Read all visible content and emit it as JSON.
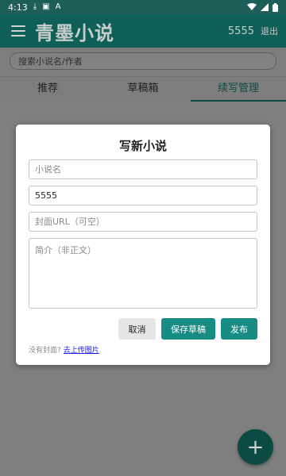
{
  "status_bar": {
    "time": "4:13",
    "icons": [
      "download-icon",
      "a-icon",
      "a-icon",
      "wifi-icon",
      "signal-icon",
      "battery-icon"
    ]
  },
  "app_bar": {
    "menu_icon": "hamburger-menu-icon",
    "title": "青墨小说",
    "username": "5555",
    "logout_label": "退出"
  },
  "search": {
    "placeholder": "搜索小说名/作者",
    "value": ""
  },
  "tabs": [
    {
      "label": "推荐",
      "active": false
    },
    {
      "label": "草稿箱",
      "active": false
    },
    {
      "label": "续写管理",
      "active": true
    }
  ],
  "dialog": {
    "title": "写新小说",
    "name_placeholder": "小说名",
    "author_value": "5555",
    "cover_placeholder": "封面URL（可空）",
    "intro_placeholder": "简介（非正文）",
    "cancel_label": "取消",
    "save_label": "保存草稿",
    "publish_label": "发布",
    "hint_text": "没有封面?",
    "upload_label": "去上传图片"
  },
  "fab": {
    "label": "+",
    "icon": "plus-icon"
  },
  "colors": {
    "app_bar": "#0e5f57",
    "primary_button": "#168c84",
    "fab": "#0c4b45",
    "overlay": "#7f7f7f",
    "link": "#1a1aee"
  }
}
